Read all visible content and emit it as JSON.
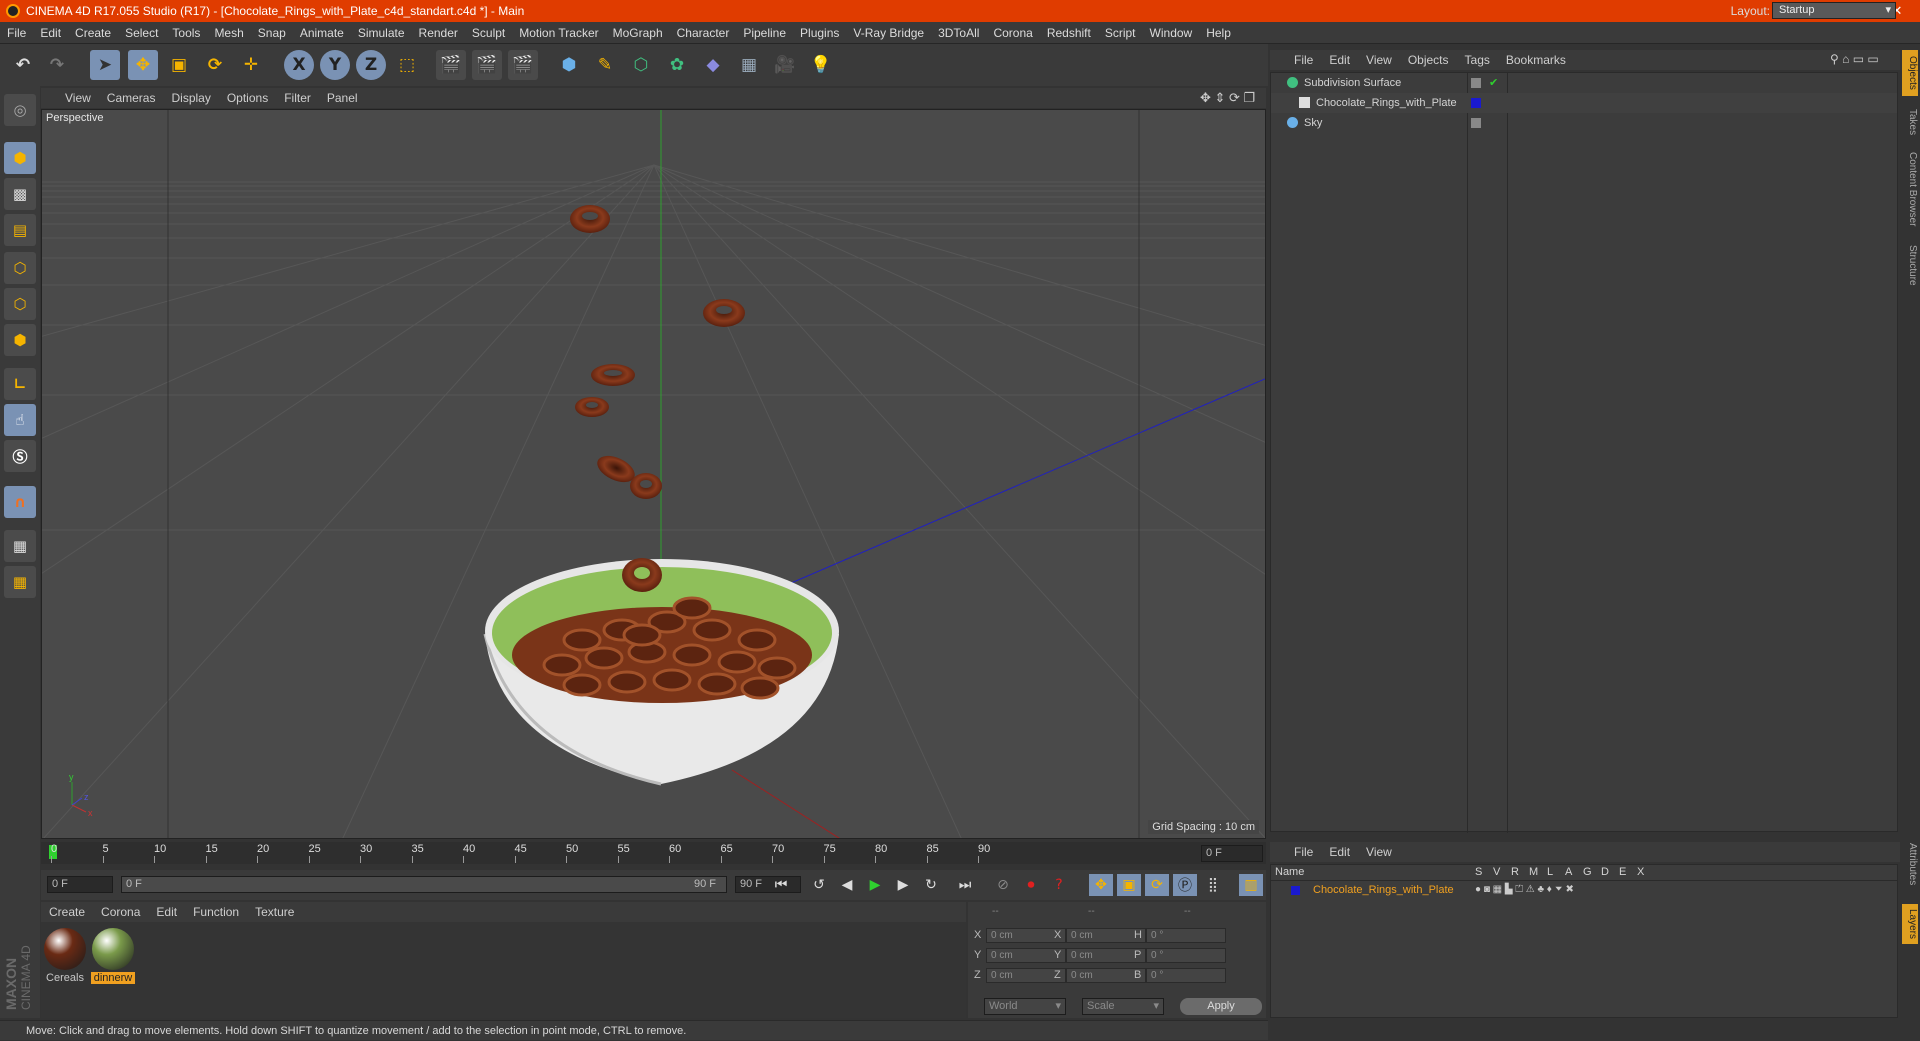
{
  "window": {
    "title": "CINEMA 4D R17.055 Studio (R17) - [Chocolate_Rings_with_Plate_c4d_standart.c4d *] - Main",
    "minimize": "—",
    "restore": "❐",
    "close": "✕"
  },
  "menubar": {
    "items": [
      "File",
      "Edit",
      "Create",
      "Select",
      "Tools",
      "Mesh",
      "Snap",
      "Animate",
      "Simulate",
      "Render",
      "Sculpt",
      "Motion Tracker",
      "MoGraph",
      "Character",
      "Pipeline",
      "Plugins",
      "V-Ray Bridge",
      "3DToAll",
      "Corona",
      "Redshift",
      "Script",
      "Window",
      "Help"
    ],
    "layout_label": "Layout:",
    "layout_value": "Startup"
  },
  "toolbar": {
    "x_label": "X",
    "y_label": "Y",
    "z_label": "Z"
  },
  "viewport": {
    "menu": [
      "View",
      "Cameras",
      "Display",
      "Options",
      "Filter",
      "Panel"
    ],
    "title": "Perspective",
    "grid_spacing": "Grid Spacing : 10 cm"
  },
  "timeline": {
    "ticks": [
      "0",
      "5",
      "10",
      "15",
      "20",
      "25",
      "30",
      "35",
      "40",
      "45",
      "50",
      "55",
      "60",
      "65",
      "70",
      "75",
      "80",
      "85",
      "90"
    ],
    "current_frame": "0 F",
    "start_field": "0 F",
    "range_start": "0 F",
    "range_end": "90 F",
    "end_field": "90 F"
  },
  "material_manager": {
    "menu": [
      "Create",
      "Corona",
      "Edit",
      "Function",
      "Texture"
    ],
    "materials": [
      {
        "name": "Cereals",
        "color": "#6a2a14",
        "selected": false
      },
      {
        "name": "dinnerw",
        "color": "#7a9a4a",
        "selected": true
      }
    ]
  },
  "coordinates": {
    "header": [
      "--",
      "--",
      "--"
    ],
    "rows": [
      {
        "axis": "X",
        "pos": "0 cm",
        "axis2": "X",
        "size": "0 cm",
        "axis3": "H",
        "rot": "0 °"
      },
      {
        "axis": "Y",
        "pos": "0 cm",
        "axis2": "Y",
        "size": "0 cm",
        "axis3": "P",
        "rot": "0 °"
      },
      {
        "axis": "Z",
        "pos": "0 cm",
        "axis2": "Z",
        "size": "0 cm",
        "axis3": "B",
        "rot": "0 °"
      }
    ],
    "world": "World",
    "scale": "Scale",
    "apply": "Apply"
  },
  "status": "Move: Click and drag to move elements. Hold down SHIFT to quantize movement / add to the selection in point mode, CTRL to remove.",
  "object_manager": {
    "menu": [
      "File",
      "Edit",
      "View",
      "Objects",
      "Tags",
      "Bookmarks"
    ],
    "objects": [
      {
        "name": "Subdivision Surface",
        "check": "✔"
      },
      {
        "name": "Chocolate_Rings_with_Plate",
        "check": ""
      },
      {
        "name": "Sky",
        "check": ""
      }
    ]
  },
  "right_tabs": [
    "Objects",
    "Takes",
    "Content Browser",
    "Structure",
    "Attributes",
    "Layers"
  ],
  "layer_manager": {
    "menu": [
      "File",
      "Edit",
      "View"
    ],
    "columns": [
      "Name",
      "S",
      "V",
      "R",
      "M",
      "L",
      "A",
      "G",
      "D",
      "E",
      "X"
    ],
    "layer_name": "Chocolate_Rings_with_Plate",
    "layer_color": "#1a1ad0"
  },
  "brand": {
    "maxon": "MAXON",
    "product": "CINEMA 4D"
  }
}
